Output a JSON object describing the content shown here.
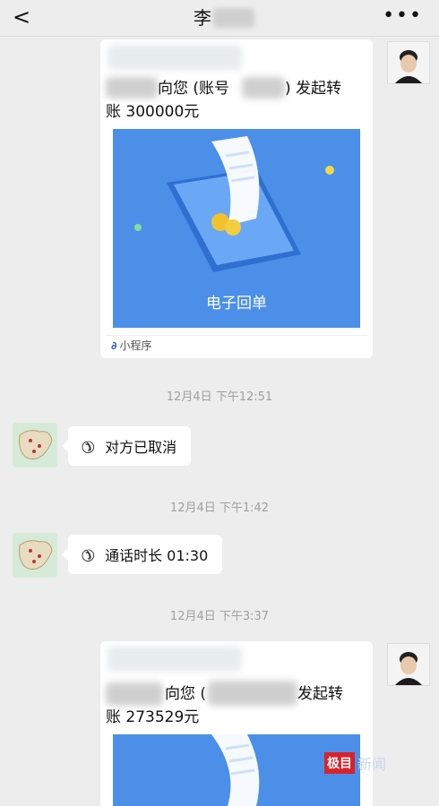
{
  "header": {
    "back_label": "<",
    "title": "李",
    "more_label": "•••"
  },
  "messages": [
    {
      "type": "transfer_card",
      "text_part1": "向您 (账号",
      "text_part2": ") 发起转",
      "text_line2": "账 300000元",
      "banner_label": "电子回单",
      "source_label": "小程序"
    },
    {
      "type": "timestamp",
      "text": "12月4日 下午12:51"
    },
    {
      "type": "call",
      "text": "对方已取消"
    },
    {
      "type": "timestamp",
      "text": "12月4日 下午1:42"
    },
    {
      "type": "call",
      "text": "通话时长 01:30"
    },
    {
      "type": "timestamp",
      "text": "12月4日 下午3:37"
    },
    {
      "type": "transfer_card",
      "text_part1": "向您 (",
      "text_part2": "发起转",
      "text_line2": "账 273529元"
    }
  ],
  "watermark": {
    "badge": "极目",
    "text": "新闻"
  },
  "colors": {
    "background": "#ededed",
    "banner_blue": "#4b8fe9",
    "watermark_red": "#d8232a"
  }
}
